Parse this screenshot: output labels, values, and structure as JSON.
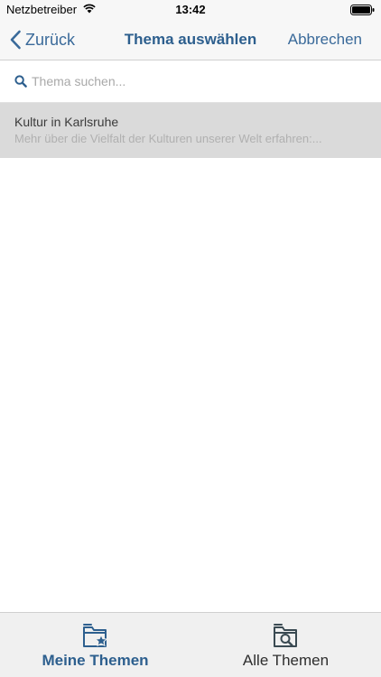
{
  "status_bar": {
    "carrier": "Netzbetreiber",
    "time": "13:42",
    "wifi_icon": "wifi-icon",
    "battery_icon": "battery-icon"
  },
  "nav": {
    "back_label": "Zurück",
    "title": "Thema auswählen",
    "cancel_label": "Abbrechen"
  },
  "search": {
    "placeholder": "Thema suchen...",
    "value": ""
  },
  "topics": [
    {
      "title": "Kultur in Karlsruhe",
      "subtitle": "Mehr über die Vielfalt der Kulturen unserer Welt erfahren:..."
    }
  ],
  "tabs": [
    {
      "label": "Meine Themen",
      "icon": "folder-star-icon",
      "active": true
    },
    {
      "label": "Alle Themen",
      "icon": "folder-search-icon",
      "active": false
    }
  ],
  "colors": {
    "accent": "#2d5f8e",
    "selected_row": "#dadada",
    "bars": "#f7f7f7"
  }
}
